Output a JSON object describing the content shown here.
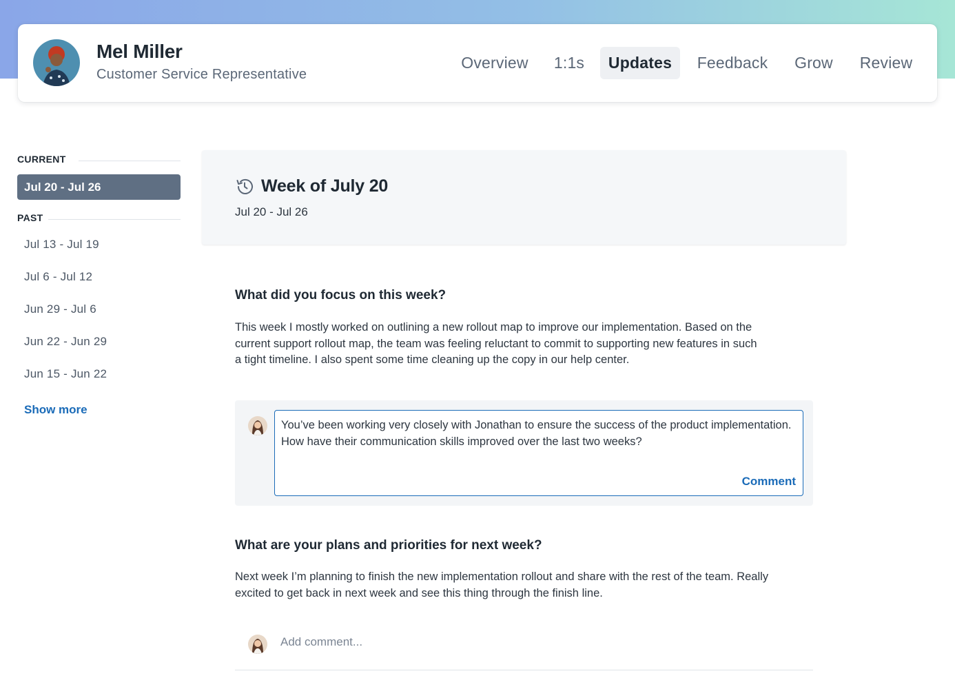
{
  "profile": {
    "name": "Mel Miller",
    "role": "Customer Service Representative"
  },
  "tabs": [
    {
      "label": "Overview",
      "active": false
    },
    {
      "label": "1:1s",
      "active": false
    },
    {
      "label": "Updates",
      "active": true
    },
    {
      "label": "Feedback",
      "active": false
    },
    {
      "label": "Grow",
      "active": false
    },
    {
      "label": "Review",
      "active": false
    }
  ],
  "sidebar": {
    "current_heading": "CURRENT",
    "current_item": "Jul 20 - Jul 26",
    "past_heading": "PAST",
    "past_items": [
      "Jul 13 - Jul 19",
      "Jul 6 - Jul 12",
      "Jun 29 - Jul 6",
      "Jun 22 - Jun 29",
      "Jun 15 - Jun 22"
    ],
    "show_more": "Show more"
  },
  "week": {
    "title": "Week of July 20",
    "range": "Jul 20 - Jul 26"
  },
  "sections": [
    {
      "question": "What did you focus on this week?",
      "answer": "This week I mostly worked on outlining a new rollout map to improve our implementation. Based on the current support rollout map, the team was feeling reluctant to commit to supporting new features in such a tight timeline. I also spent some time cleaning up the copy in our help center."
    },
    {
      "question": "What are your plans and priorities for next week?",
      "answer": "Next week I’m planning to finish the new implementation rollout and share with the rest of the team. Really excited to get back in next week and see this thing through the finish line."
    }
  ],
  "comment": {
    "text": "You’ve been working very closely with Jonathan to ensure the success of the product implementation. How have their communication skills improved over the last two weeks?",
    "button": "Comment",
    "add_placeholder": "Add comment..."
  },
  "colors": {
    "accent": "#1a6bb8",
    "selected_bg": "#5f6f83"
  }
}
